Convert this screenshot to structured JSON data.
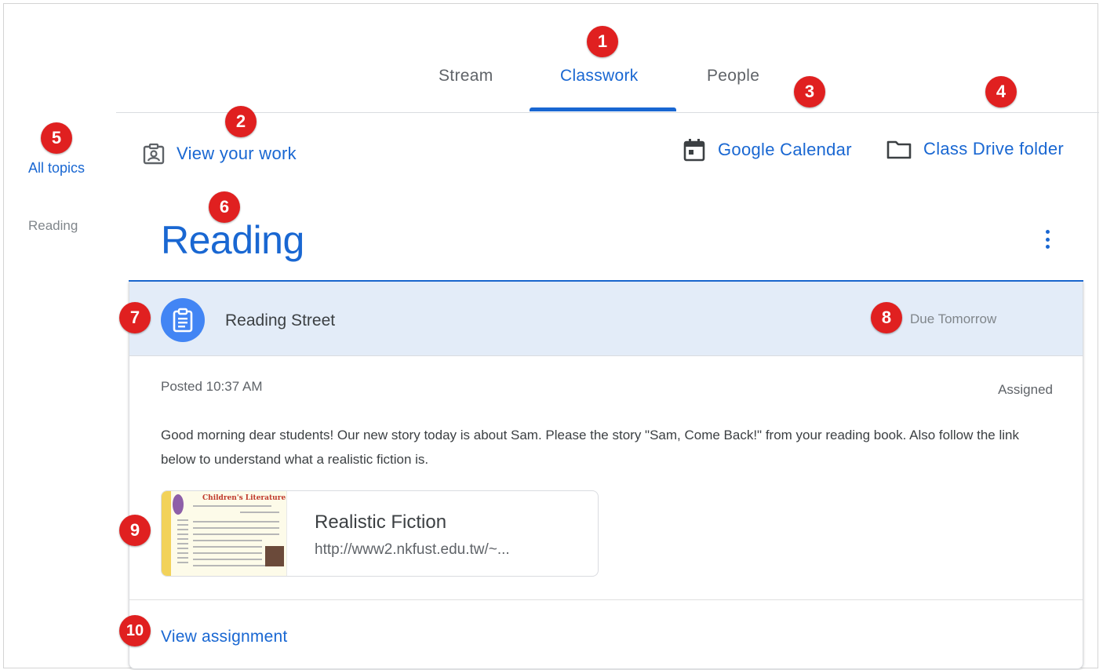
{
  "tabs": [
    {
      "label": "Stream"
    },
    {
      "label": "Classwork"
    },
    {
      "label": "People"
    }
  ],
  "active_tab": "Classwork",
  "sidebar": {
    "items": [
      {
        "label": "All topics"
      },
      {
        "label": "Reading"
      }
    ]
  },
  "toolbar": {
    "view_work": "View your work",
    "google_calendar": "Google Calendar",
    "drive_folder": "Class Drive folder"
  },
  "topic": {
    "title": "Reading"
  },
  "assignment": {
    "title": "Reading Street",
    "due": "Due Tomorrow",
    "posted": "Posted 10:37 AM",
    "status": "Assigned",
    "description": "Good morning dear students! Our new story today is about Sam. Please the story \"Sam, Come Back!\" from your reading book. Also follow the link below to understand what a realistic fiction is.",
    "attachment": {
      "title": "Realistic Fiction",
      "url": "http://www2.nkfust.edu.tw/~...",
      "thumbnail_heading": "Children's Literature"
    },
    "view_link": "View assignment"
  },
  "callouts": [
    "1",
    "2",
    "3",
    "4",
    "5",
    "6",
    "7",
    "8",
    "9",
    "10"
  ],
  "colors": {
    "accent": "#1967d2",
    "header_band": "#e3ecf8",
    "callout": "#e02020",
    "assignment_icon_bg": "#4285f4"
  },
  "icons": {
    "view_work": "portrait-icon",
    "google_calendar": "calendar-icon",
    "drive_folder": "folder-icon",
    "assignment": "assignment-icon",
    "menu": "more-vert-icon"
  }
}
